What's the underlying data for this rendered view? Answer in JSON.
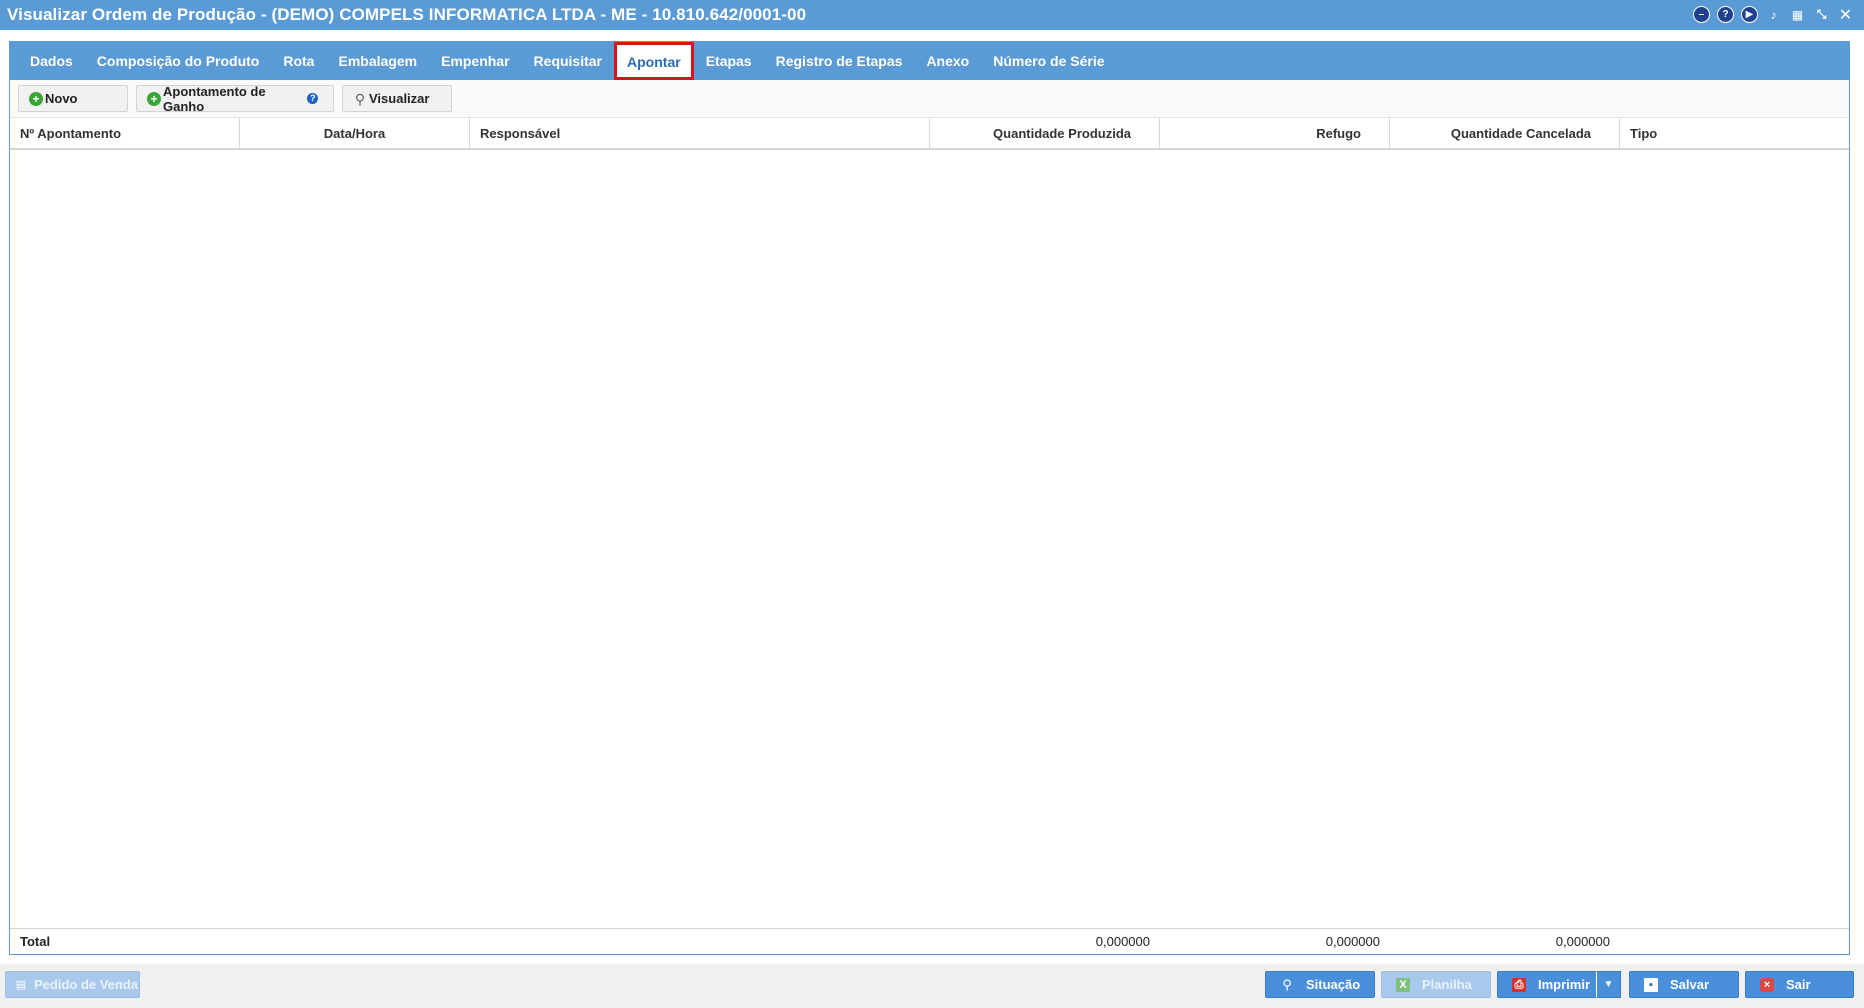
{
  "window": {
    "title": "Visualizar Ordem de Produção - (DEMO) COMPELS INFORMATICA LTDA - ME - 10.810.642/0001-00",
    "icons": [
      "minimize-icon",
      "help-icon",
      "play-icon",
      "bell-icon",
      "calendar-icon",
      "collapse-icon",
      "close-icon"
    ]
  },
  "tabs": [
    {
      "label": "Dados",
      "name": "tab-dados"
    },
    {
      "label": "Composição do Produto",
      "name": "tab-composicao-do-produto"
    },
    {
      "label": "Rota",
      "name": "tab-rota"
    },
    {
      "label": "Embalagem",
      "name": "tab-embalagem"
    },
    {
      "label": "Empenhar",
      "name": "tab-empenhar"
    },
    {
      "label": "Requisitar",
      "name": "tab-requisitar"
    },
    {
      "label": "Apontar",
      "name": "tab-apontar",
      "active": true
    },
    {
      "label": "Etapas",
      "name": "tab-etapas"
    },
    {
      "label": "Registro de Etapas",
      "name": "tab-registro-de-etapas"
    },
    {
      "label": "Anexo",
      "name": "tab-anexo"
    },
    {
      "label": "Número de Série",
      "name": "tab-numero-de-serie"
    }
  ],
  "toolbar": {
    "novo_label": "Novo",
    "ganho_label": "Apontamento de Ganho",
    "visualizar_label": "Visualizar"
  },
  "grid": {
    "columns": [
      "Nº Apontamento",
      "Data/Hora",
      "Responsável",
      "Quantidade Produzida",
      "Refugo",
      "Quantidade Cancelada",
      "Tipo"
    ],
    "rows": [],
    "footer": {
      "label": "Total",
      "quantidade_produzida": "0,000000",
      "refugo": "0,000000",
      "quantidade_cancelada": "0,000000"
    }
  },
  "bottom": {
    "pedido_de_venda": "Pedido de Venda",
    "situacao": "Situação",
    "planilha": "Planilha",
    "imprimir": "Imprimir",
    "salvar": "Salvar",
    "sair": "Sair"
  },
  "colors": {
    "accent": "#5b9bd5",
    "active_tab_highlight": "#e0101a",
    "button_blue": "#4a8fd9"
  }
}
